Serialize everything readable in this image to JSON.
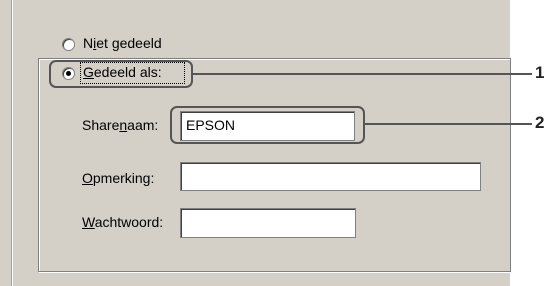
{
  "sharing": {
    "option_not_shared": {
      "pre": "N",
      "accel": "i",
      "post": "et gedeeld"
    },
    "option_shared_as": {
      "pre": "",
      "accel": "G",
      "post": "edeeld als:"
    },
    "selected": "shared_as"
  },
  "fields": {
    "share_name": {
      "pre": "Share",
      "accel": "n",
      "post": "aam:",
      "value": "EPSON"
    },
    "comment": {
      "pre": "",
      "accel": "O",
      "post": "pmerking:",
      "value": ""
    },
    "password": {
      "pre": "",
      "accel": "W",
      "post": "achtwoord:",
      "value": ""
    }
  },
  "callouts": [
    "1",
    "2"
  ]
}
